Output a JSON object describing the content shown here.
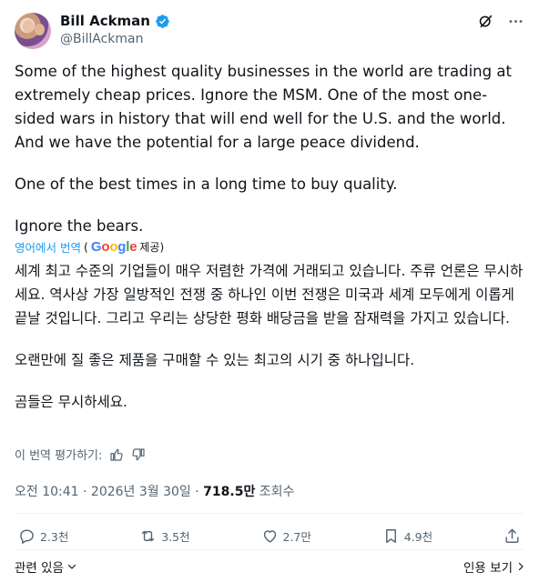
{
  "author": {
    "display_name": "Bill Ackman",
    "handle": "@BillAckman"
  },
  "tweet": {
    "para1": "Some of the highest quality businesses in the world are trading at extremely cheap prices. Ignore the MSM. One of the most one-sided wars in history that will end well for the U.S. and the world. And we have the potential for a large peace dividend.",
    "para2": "One of the best times in a long time to buy quality.",
    "para3": "Ignore the bears."
  },
  "translation": {
    "label": "영어에서 번역",
    "provider": "Google",
    "provided": "제공)",
    "para1": "세계 최고 수준의 기업들이 매우 저렴한 가격에 거래되고 있습니다. 주류 언론은 무시하세요. 역사상 가장 일방적인 전쟁 중 하나인 이번 전쟁은 미국과 세계 모두에게 이롭게 끝날 것입니다. 그리고 우리는 상당한 평화 배당금을 받을 잠재력을 가지고 있습니다.",
    "para2": "오랜만에 질 좋은 제품을 구매할 수 있는 최고의 시기 중 하나입니다.",
    "para3": "곰들은 무시하세요.",
    "rate_label": "이 번역 평가하기:"
  },
  "meta": {
    "time": "오전 10:41 · 2026년 3월 30일 · ",
    "views": "718.5만",
    "views_label": " 조회수"
  },
  "actions": {
    "replies": "2.3천",
    "reposts": "3.5천",
    "likes": "2.7만",
    "bookmarks": "4.9천"
  },
  "footer": {
    "related": "관련 있음",
    "show_more": "인용 보기"
  },
  "colors": {
    "accent": "#1d9bf0",
    "muted": "#536471"
  }
}
